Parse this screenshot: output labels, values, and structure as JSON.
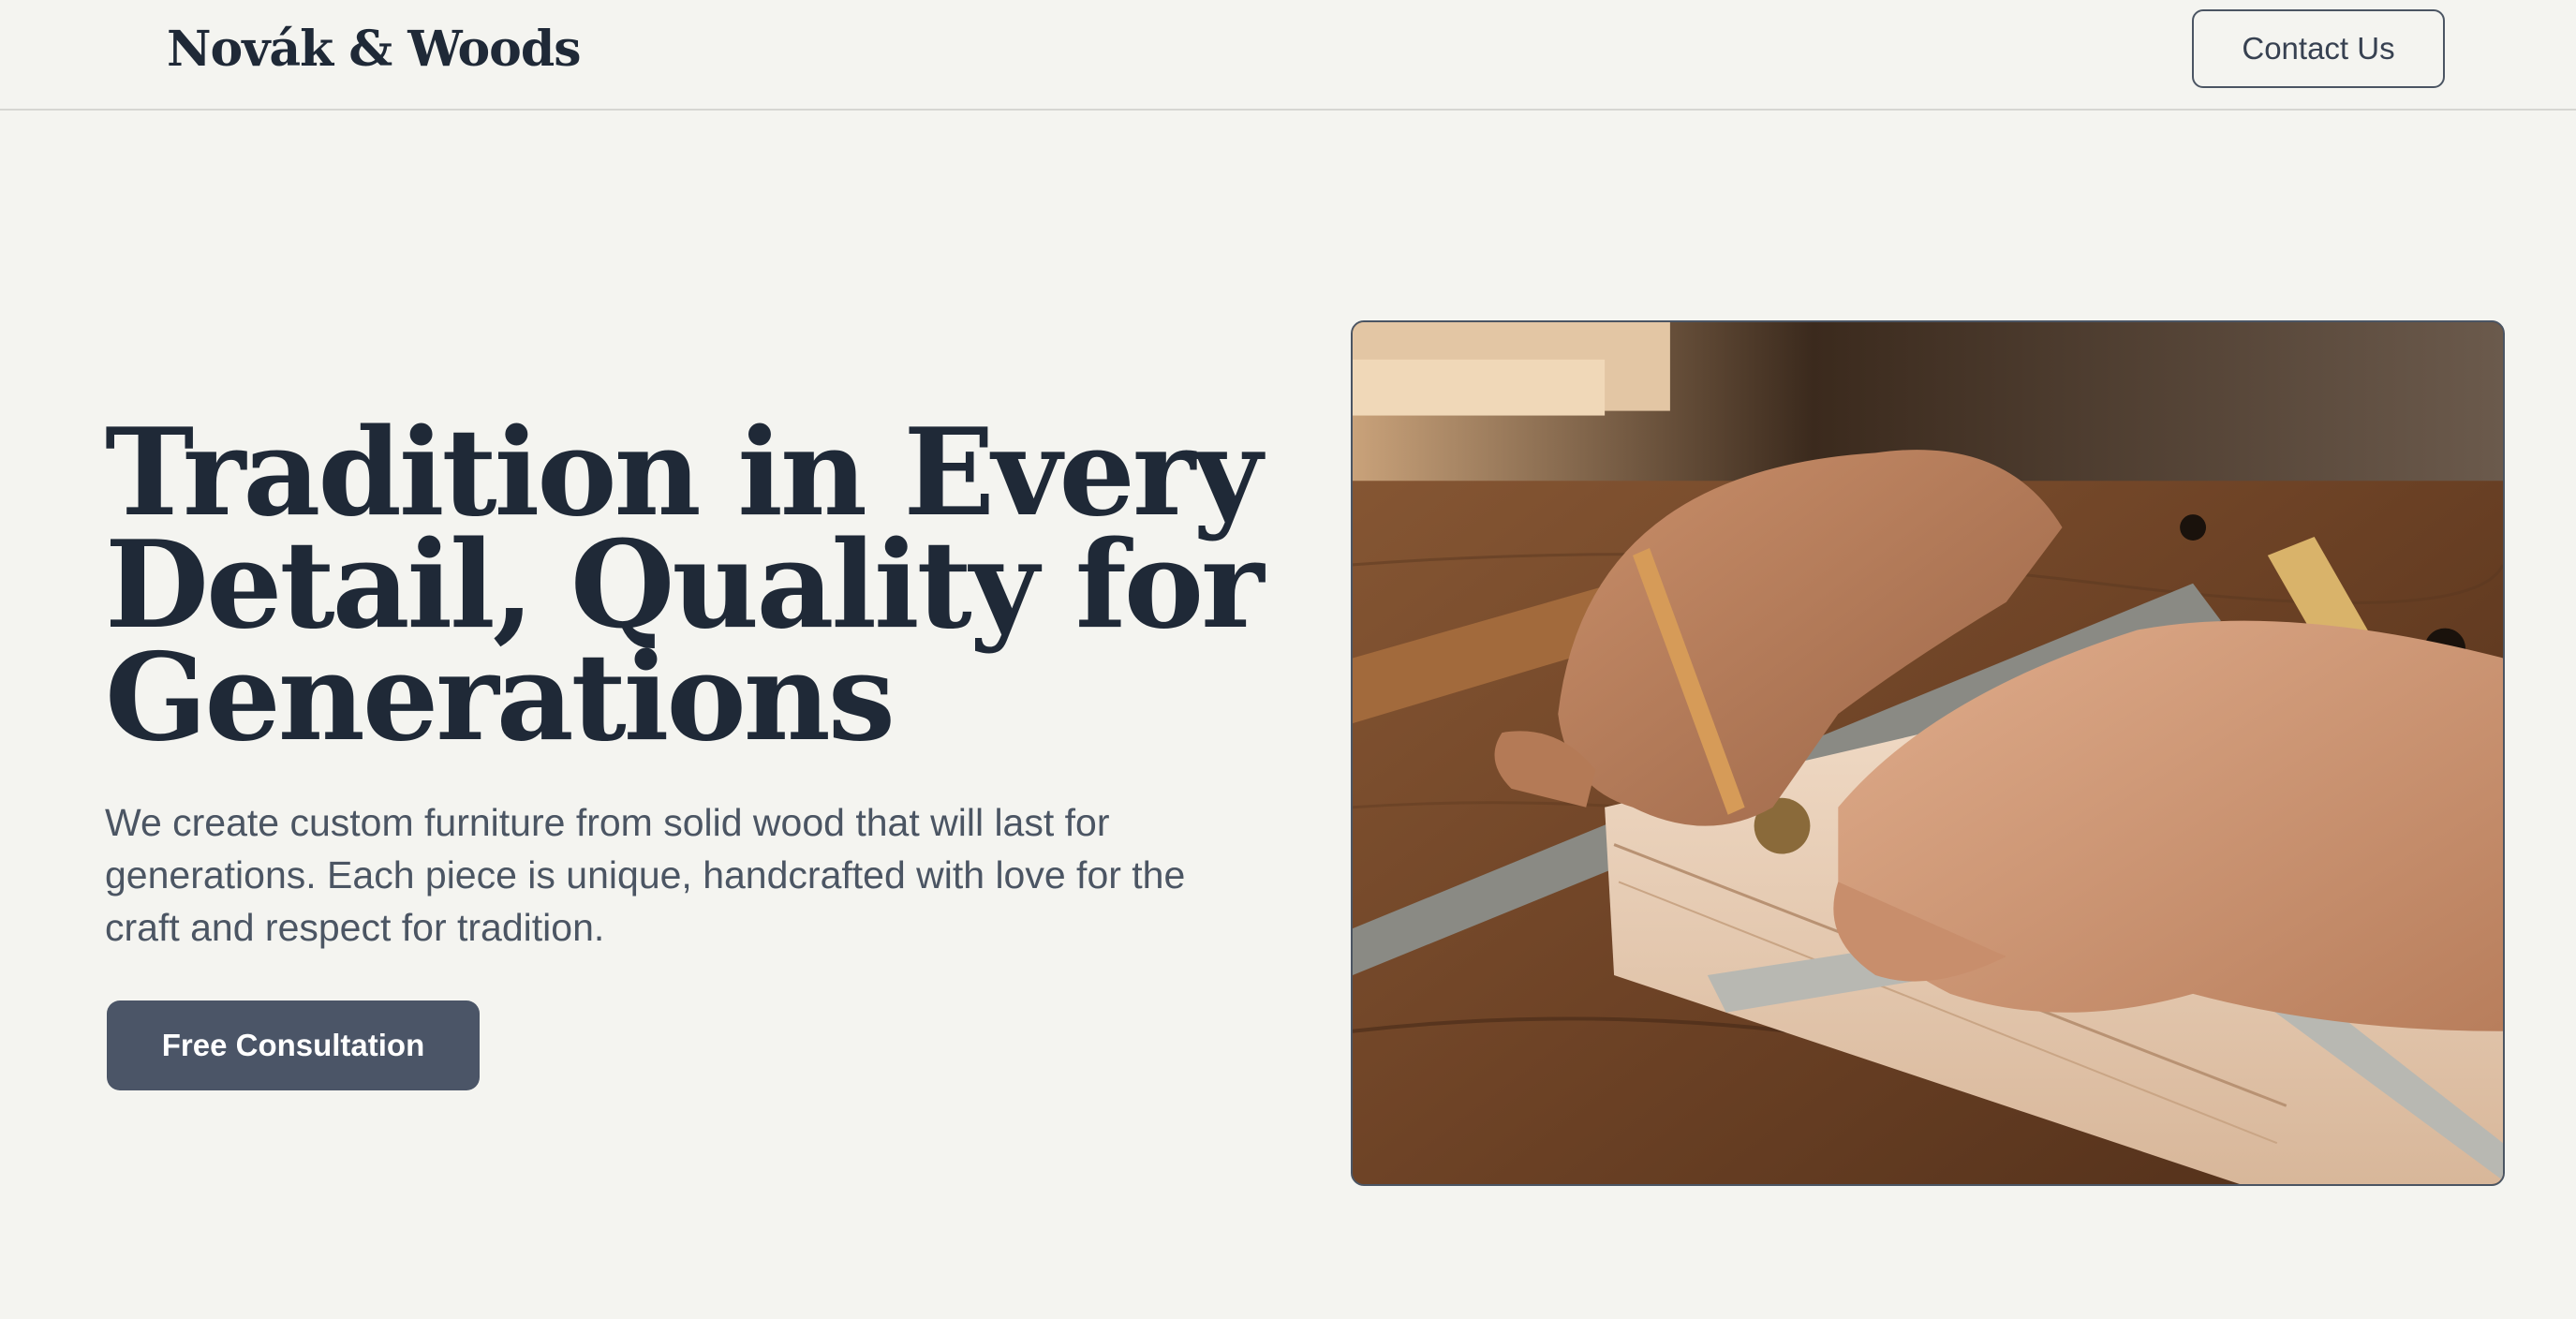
{
  "header": {
    "logo": "Novák & Woods",
    "contact_label": "Contact Us"
  },
  "hero": {
    "title": "Tradition in Every Detail, Quality for Generations",
    "description": "We create custom furniture from solid wood that will last for generations. Each piece is unique, handcrafted with love for the craft and respect for tradition.",
    "cta_label": "Free Consultation"
  },
  "colors": {
    "background": "#f4f4f0",
    "text_primary": "#1f2937",
    "text_secondary": "#4b5563",
    "button_primary": "#4b5567",
    "border": "#4b5563"
  }
}
